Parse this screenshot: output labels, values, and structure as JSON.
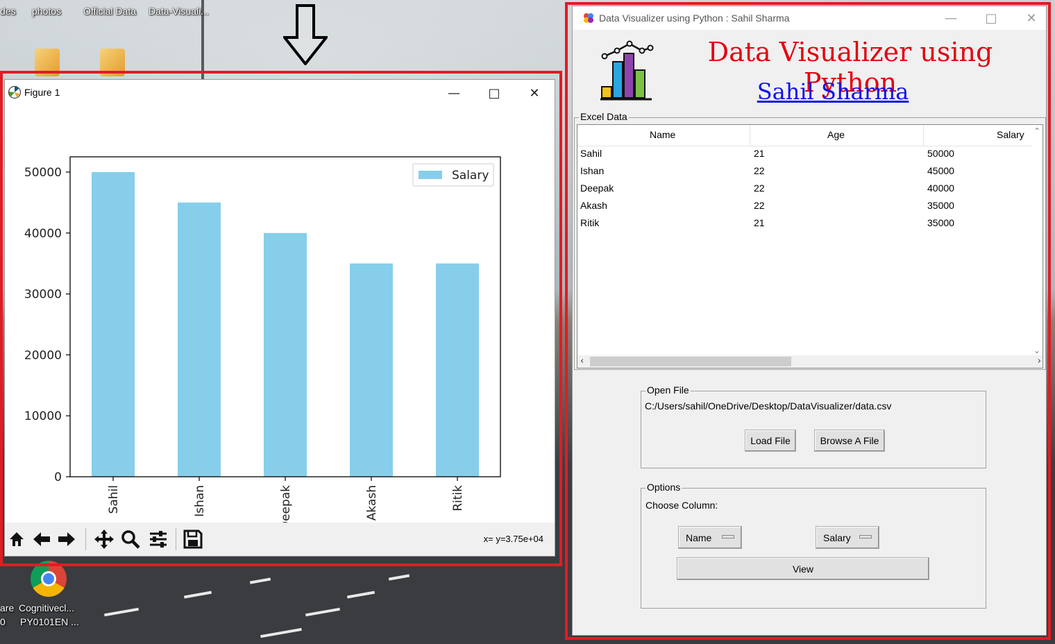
{
  "desktop": {
    "top_icons": [
      "des",
      "photos",
      "Official Data",
      "Data-Visuali..."
    ],
    "bottom_icons": [
      "are",
      "Cognitivecl...",
      "PY0101EN ...",
      "0"
    ]
  },
  "figure_window": {
    "title": "Figure 1",
    "coords_readout": "x= y=3.75e+04",
    "toolbar": [
      "home-icon",
      "back-icon",
      "forward-icon",
      "pan-icon",
      "zoom-icon",
      "configure-icon",
      "save-icon"
    ]
  },
  "chart_data": {
    "type": "bar",
    "categories": [
      "Sahil",
      "Ishan",
      "Deepak",
      "Akash",
      "Ritik"
    ],
    "series": [
      {
        "name": "Salary",
        "values": [
          50000,
          45000,
          40000,
          35000,
          35000
        ],
        "color": "#87ceeb"
      }
    ],
    "yticks": [
      "0",
      "10000",
      "20000",
      "30000",
      "40000",
      "50000"
    ],
    "ylim": [
      0,
      52500
    ],
    "legend": "top-right",
    "grid": false,
    "xlabel_rotation": "vertical"
  },
  "app_window": {
    "title": "Data Visualizer using Python : Sahil Sharma",
    "heading": "Data Visualizer using Python",
    "author": "Sahil Sharma",
    "excel_frame_label": "Excel Data",
    "table": {
      "columns": [
        "Name",
        "Age",
        "Salary"
      ],
      "rows": [
        [
          "Sahil",
          "21",
          "50000"
        ],
        [
          "Ishan",
          "22",
          "45000"
        ],
        [
          "Deepak",
          "22",
          "40000"
        ],
        [
          "Akash",
          "22",
          "35000"
        ],
        [
          "Ritik",
          "21",
          "35000"
        ]
      ]
    },
    "open_file": {
      "label": "Open File",
      "path": "C:/Users/sahil/OneDrive/Desktop/DataVisualizer/data.csv",
      "load_button": "Load File",
      "browse_button": "Browse A File"
    },
    "options": {
      "label": "Options",
      "choose_column": "Choose Column:",
      "x_column": "Name",
      "y_column": "Salary",
      "view_button": "View"
    }
  },
  "colors": {
    "highlight": "#e31b23",
    "heading": "#e3000f",
    "author": "#1010ee",
    "bar": "#87ceeb"
  }
}
